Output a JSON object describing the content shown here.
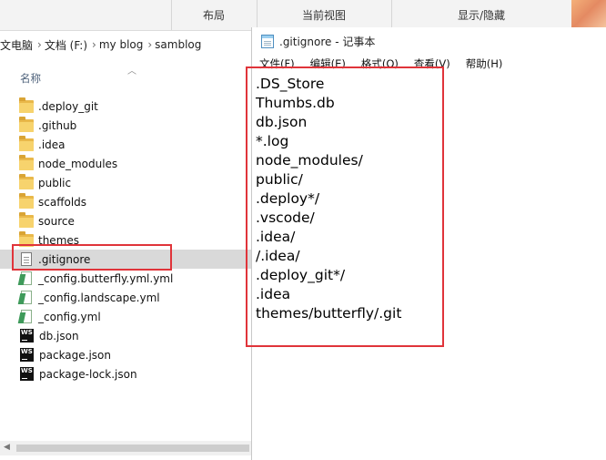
{
  "ribbon": {
    "groups": [
      "",
      "布局",
      "当前视图",
      "显示/隐藏"
    ]
  },
  "explorer": {
    "breadcrumb": [
      "文电脑",
      "文档 (F:)",
      "my blog",
      "samblog"
    ],
    "column_header": "名称",
    "items": [
      {
        "name": ".deploy_git",
        "type": "folder"
      },
      {
        "name": ".github",
        "type": "folder"
      },
      {
        "name": ".idea",
        "type": "folder"
      },
      {
        "name": "node_modules",
        "type": "folder"
      },
      {
        "name": "public",
        "type": "folder"
      },
      {
        "name": "scaffolds",
        "type": "folder"
      },
      {
        "name": "source",
        "type": "folder"
      },
      {
        "name": "themes",
        "type": "folder"
      },
      {
        "name": ".gitignore",
        "type": "text-file",
        "selected": true
      },
      {
        "name": "_config.butterfly.yml.yml",
        "type": "yml-file"
      },
      {
        "name": "_config.landscape.yml",
        "type": "yml-file"
      },
      {
        "name": "_config.yml",
        "type": "yml-file"
      },
      {
        "name": "db.json",
        "type": "webstorm-file"
      },
      {
        "name": "package.json",
        "type": "webstorm-file"
      },
      {
        "name": "package-lock.json",
        "type": "webstorm-file"
      }
    ]
  },
  "notepad": {
    "title": ".gitignore - 记事本",
    "menu": [
      "文件(F)",
      "编辑(E)",
      "格式(O)",
      "查看(V)",
      "帮助(H)"
    ],
    "lines": [
      ".DS_Store",
      "Thumbs.db",
      "db.json",
      "*.log",
      "node_modules/",
      "public/",
      ".deploy*/",
      ".vscode/",
      ".idea/",
      "/.idea/",
      ".deploy_git*/",
      ".idea",
      "themes/butterfly/.git"
    ]
  },
  "colors": {
    "highlight": "#e0343a",
    "selection": "#d9d9d9",
    "folder": "#f7d36d"
  }
}
